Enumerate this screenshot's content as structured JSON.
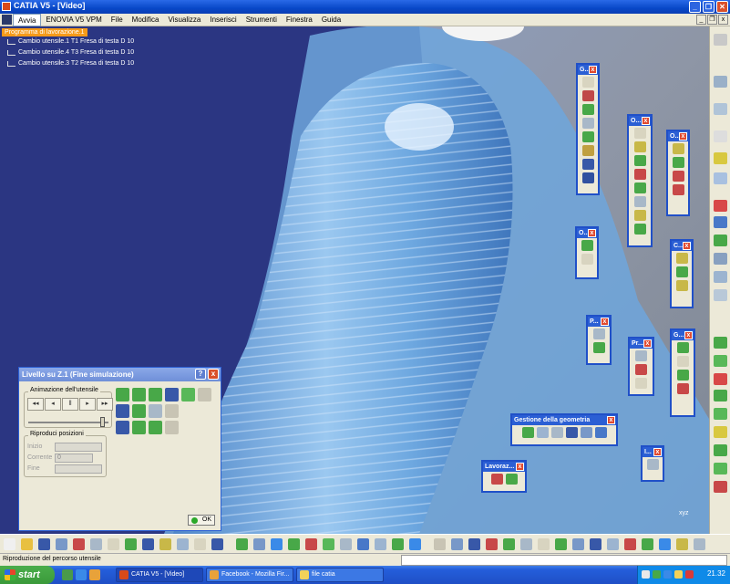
{
  "window": {
    "title": "CATIA V5 - [Video]"
  },
  "menu": {
    "items": [
      "Avvia",
      "ENOVIA V5 VPM",
      "File",
      "Modifica",
      "Visualizza",
      "Inserisci",
      "Strumenti",
      "Finestra",
      "Guida"
    ],
    "active": "Avvia"
  },
  "tree": {
    "root": "Programma di lavorazione.1",
    "nodes": [
      "Cambio utensile.1  T1 Fresa di testa D 10",
      "Cambio utensile.4  T3 Fresa di testa D 10",
      "Cambio utensile.3  T2 Fresa di testa D 10"
    ]
  },
  "toolbars": {
    "t1": "G...",
    "t2": "O...",
    "t3": "O...",
    "t4": "O...",
    "t5": "C...",
    "t6": "P...",
    "t7": "Pr...",
    "t8": "G...",
    "t9": "Gestione della geometria",
    "t10": "Lavoraz...",
    "t11": "I..."
  },
  "dialog": {
    "title": "Livello su Z.1 (Fine simulazione)",
    "help": "?",
    "close": "x",
    "animation_group": "Animazione dell'utensile",
    "positions_group": "Riproduci posizioni",
    "play_buttons": [
      "◂◂",
      "◂",
      "ll",
      "▸",
      "▸▸"
    ],
    "slider_fraction": 0.95,
    "fields": [
      {
        "label": "Inizio",
        "value": ""
      },
      {
        "label": "Corrente",
        "value": "0"
      },
      {
        "label": "Fine",
        "value": ""
      }
    ],
    "ok": "OK"
  },
  "status": {
    "text": "Riproduzione del percorso utensile"
  },
  "taskbar": {
    "start": "start",
    "tasks": [
      "CATIA V5 - [Video]",
      "Facebook - Mozilla Fir...",
      "file catia"
    ],
    "clock": "21.32"
  },
  "compass_label": "xyz"
}
